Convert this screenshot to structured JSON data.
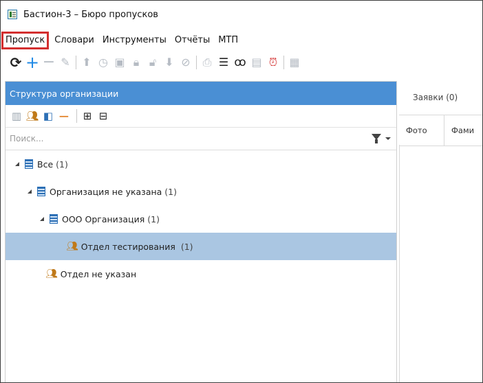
{
  "window": {
    "title": "Бастион-3 – Бюро пропусков"
  },
  "menu": {
    "items": [
      "Пропуск",
      "Словари",
      "Инструменты",
      "Отчёты",
      "МТП"
    ],
    "highlighted": "Пропуск"
  },
  "toolbar": {
    "icons": [
      "refresh-icon",
      "add-icon",
      "remove-icon",
      "edit-icon",
      "upload-icon",
      "add-time-icon",
      "photo-id-icon",
      "lock-icon",
      "unlock-icon",
      "download-icon",
      "block-icon",
      "print-icon",
      "barcode-icon",
      "find-user-icon",
      "card-icon",
      "pass-alarm-icon",
      "card-list-icon"
    ]
  },
  "left_panel": {
    "header": "Структура организации",
    "search_placeholder": "Поиск...",
    "tree": [
      {
        "label": "Все",
        "count": "(1)",
        "level": 0,
        "icon": "building-icon",
        "expanded": true
      },
      {
        "label": "Организация не указана",
        "count": "(1)",
        "level": 1,
        "icon": "building-icon",
        "expanded": true
      },
      {
        "label": "ООО Организация",
        "count": "(1)",
        "level": 2,
        "icon": "building-icon",
        "expanded": true
      },
      {
        "label": "Отдел тестирования",
        "count": "(1)",
        "level": 3,
        "icon": "department-icon",
        "selected": true
      },
      {
        "label": "Отдел не указан",
        "count": "",
        "level": 2,
        "icon": "department-icon"
      }
    ]
  },
  "right_panel": {
    "tab": "Заявки (0)",
    "columns": [
      "Фото",
      "Фами"
    ]
  },
  "colors": {
    "panel_header": "#4a8fd4",
    "selected_row": "#aac6e2",
    "highlight": "#d32f2f",
    "accent": "#1e88e5"
  }
}
